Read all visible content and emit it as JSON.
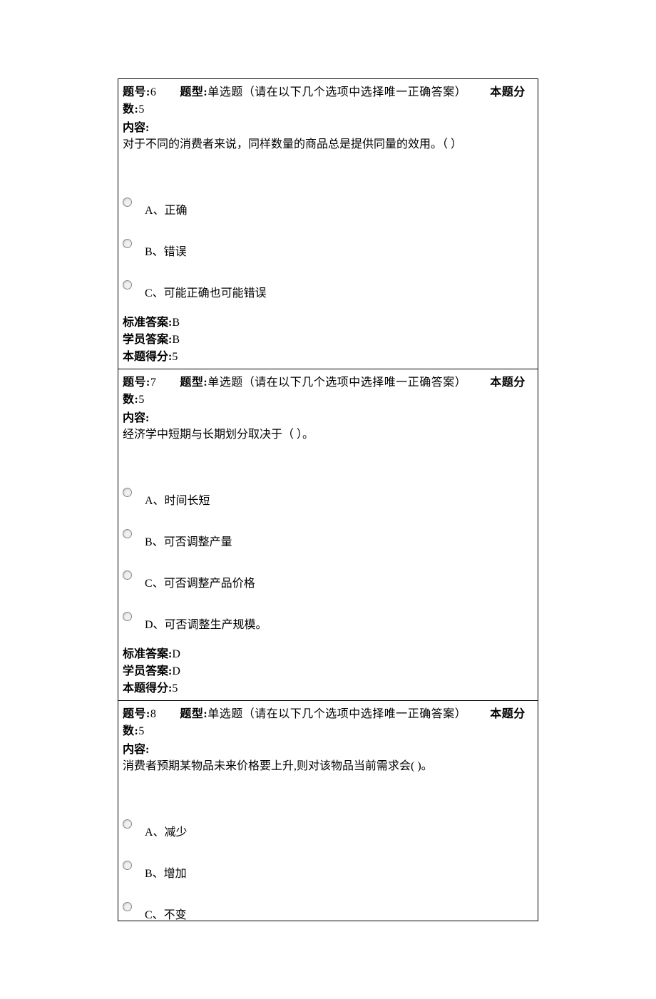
{
  "labels": {
    "questionNo": "题号:",
    "questionType": "题型:",
    "typeDesc": "单选题（请在以下几个选项中选择唯一正确答案）",
    "fullScore": "本题分数:",
    "content": "内容:",
    "stdAnswer": "标准答案:",
    "userAnswer": "学员答案:",
    "gotScore": "本题得分:"
  },
  "questions": [
    {
      "no": "6",
      "score": "5",
      "text": "对于不同的消费者来说，同样数量的商品总是提供同量的效用。（ ）",
      "options": [
        "A、正确",
        "B、错误",
        "C、可能正确也可能错误"
      ],
      "std": "B",
      "user": "B",
      "got": "5"
    },
    {
      "no": "7",
      "score": "5",
      "text": "经济学中短期与长期划分取决于（ ）。",
      "options": [
        "A、时间长短",
        "B、可否调整产量",
        "C、可否调整产品价格",
        "D、可否调整生产规模。"
      ],
      "std": "D",
      "user": "D",
      "got": "5"
    },
    {
      "no": "8",
      "score": "5",
      "text": "消费者预期某物品未来价格要上升,则对该物品当前需求会( )。",
      "options": [
        "A、减少",
        "B、增加",
        "C、不变"
      ],
      "std": null,
      "user": null,
      "got": null
    }
  ]
}
